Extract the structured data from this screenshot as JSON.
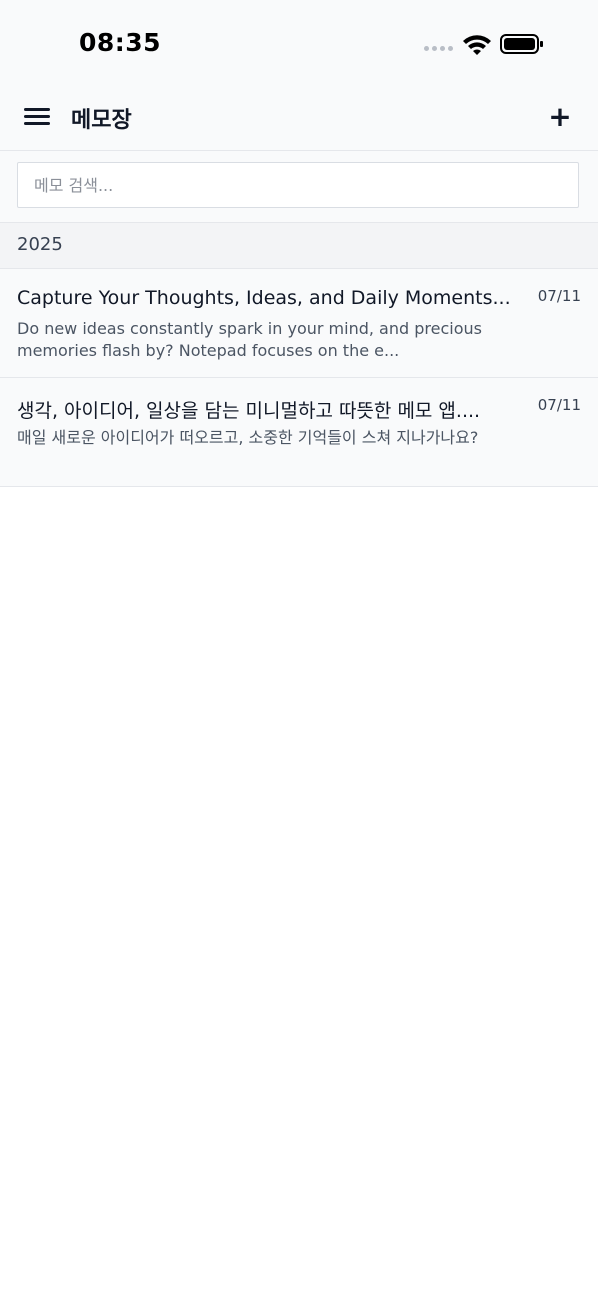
{
  "status_bar": {
    "time": "08:35"
  },
  "header": {
    "title": "메모장",
    "menu_icon": "hamburger-menu-icon",
    "add_label": "+"
  },
  "search": {
    "placeholder": "메모 검색...",
    "value": ""
  },
  "groups": [
    {
      "year": "2025",
      "memos": [
        {
          "title": "Capture Your Thoughts, Ideas, and Daily Moments...",
          "date": "07/11",
          "preview": "Do new ideas constantly spark in your mind, and precious memories flash by? Notepad focuses on the e..."
        },
        {
          "title": "생각, 아이디어, 일상을 담는 미니멀하고 따뜻한 메모 앱....",
          "date": "07/11",
          "preview": "매일 새로운 아이디어가 떠오르고, 소중한 기억들이 스쳐 지나가나요?"
        }
      ]
    }
  ],
  "colors": {
    "header_bg": "#f9fafb",
    "year_bg": "#f3f4f6",
    "divider": "#e5e7eb",
    "text_primary": "#111827",
    "text_secondary": "#4b5563"
  }
}
